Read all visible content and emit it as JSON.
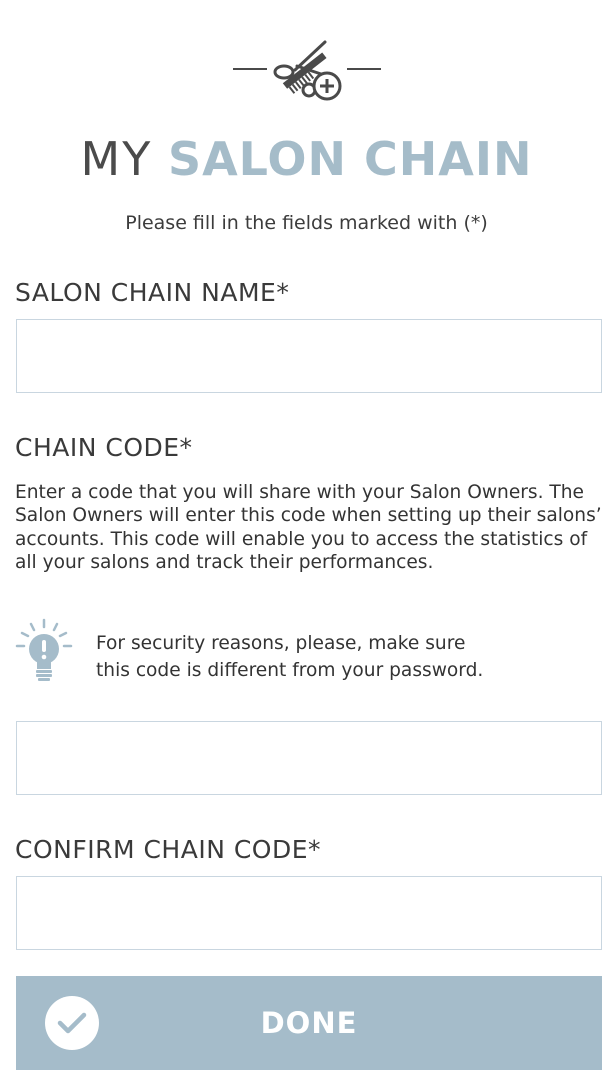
{
  "header": {
    "icon": "scissors-comb-plus-icon",
    "title_light": "MY",
    "title_strong": "SALON CHAIN",
    "instructions": "Please fill in the fields marked with (*)"
  },
  "fields": {
    "chain_name": {
      "label": "SALON CHAIN NAME*",
      "value": "",
      "placeholder": ""
    },
    "chain_code": {
      "label": "CHAIN CODE*",
      "description": "Enter a code that you will share with your Salon Owners. The Salon Owners will enter this code when setting up their salons’ accounts. This code will enable you to access the statistics of all your salons and track their performances.",
      "tip_icon": "lightbulb-icon",
      "tip_line1": "For security reasons, please, make sure",
      "tip_line2": "this code is different from your password.",
      "value": "",
      "placeholder": ""
    },
    "confirm_chain_code": {
      "label": "CONFIRM CHAIN CODE*",
      "value": "",
      "placeholder": ""
    }
  },
  "done_button": {
    "label": "DONE",
    "icon": "checkmark-icon"
  },
  "colors": {
    "accent": "#a5bcca",
    "input_border": "#c9d6e0",
    "text": "#3a3a3a"
  }
}
